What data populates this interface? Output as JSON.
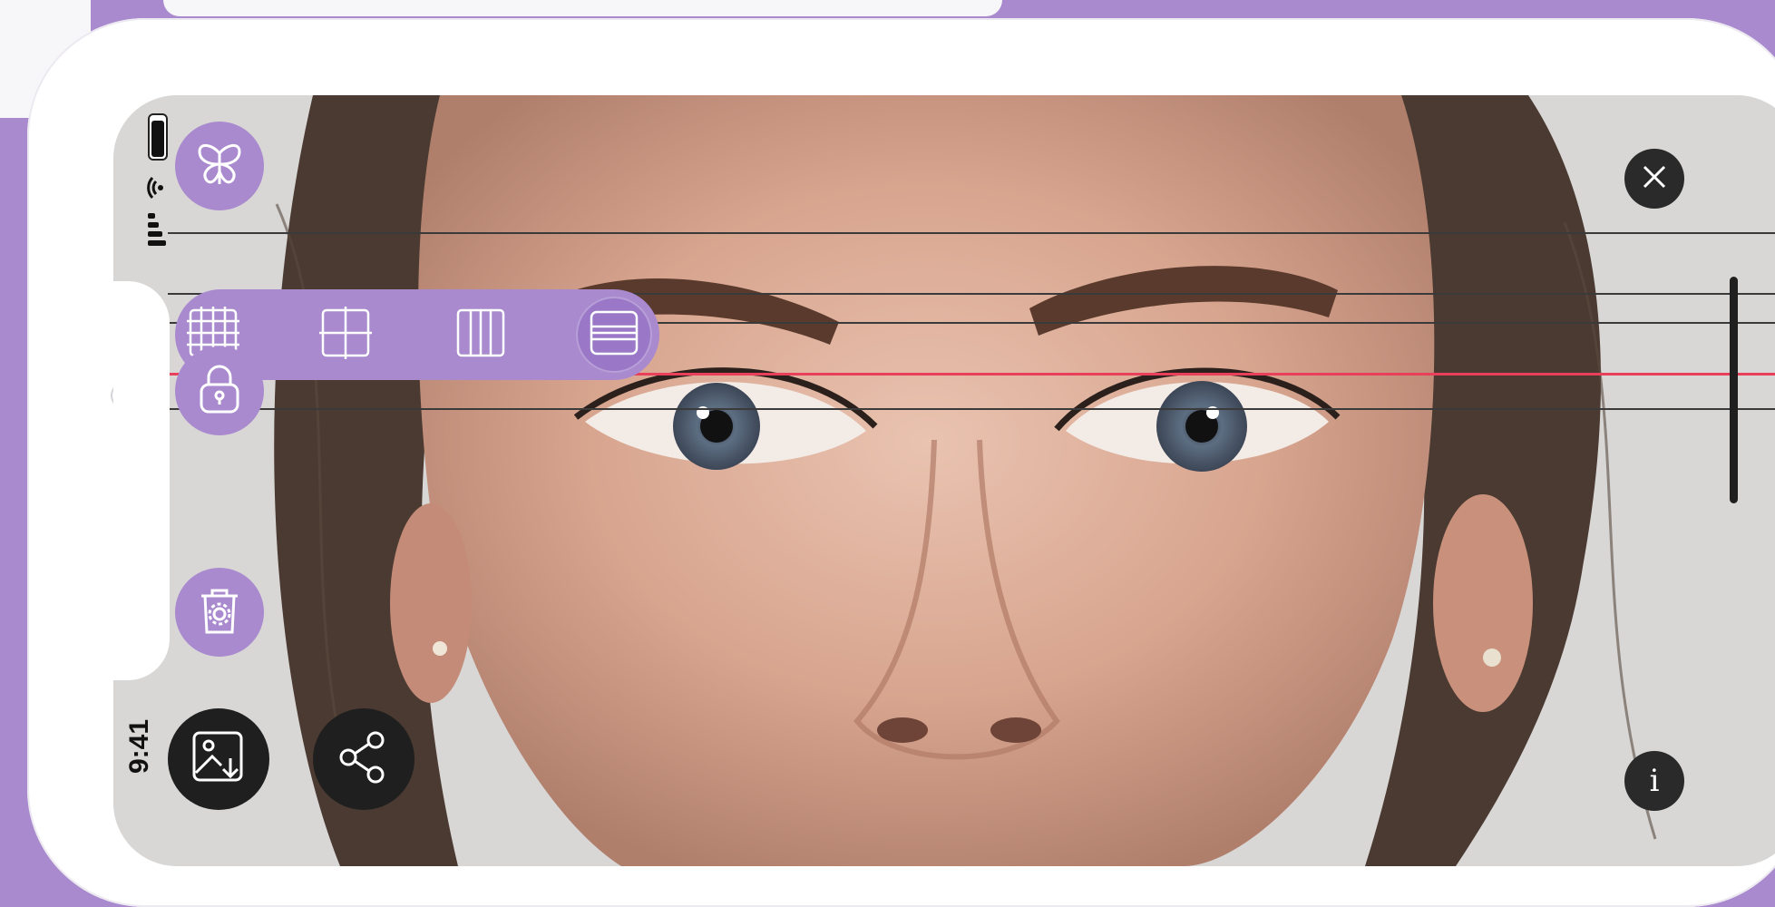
{
  "status_bar": {
    "time": "9:41"
  },
  "toolbar": {
    "butterfly_icon": "butterfly-icon",
    "grid_options": [
      {
        "name": "grid-dense",
        "icon": "grid-3x3-icon",
        "active": false
      },
      {
        "name": "grid-cross",
        "icon": "grid-cross-icon",
        "active": false
      },
      {
        "name": "grid-vertical",
        "icon": "grid-vertical-icon",
        "active": false
      },
      {
        "name": "grid-horizontal",
        "icon": "grid-horizontal-icon",
        "active": true
      }
    ],
    "lock_icon": "lock-icon",
    "delete_icon": "trash-gear-icon",
    "save_icon": "image-download-icon",
    "share_icon": "share-icon"
  },
  "controls": {
    "close_icon": "close-icon",
    "info_label": "i"
  },
  "colors": {
    "accent": "#a98ace",
    "guide_line": "#3a3a3a",
    "highlight_line": "#e8405a",
    "dark_button": "#1f1f1f"
  }
}
